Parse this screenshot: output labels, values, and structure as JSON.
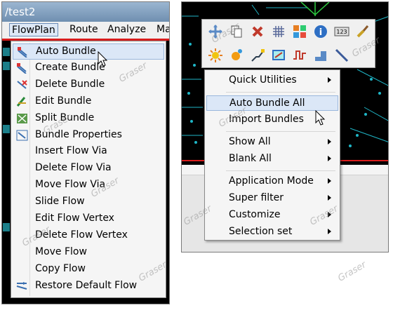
{
  "left_window": {
    "title": "/test2",
    "menubar": [
      "FlowPlan",
      "Route",
      "Analyze",
      "Ma"
    ],
    "dropdown_items": [
      {
        "label": "Auto Bundle",
        "icon": "bundle-icon",
        "highlighted": true
      },
      {
        "label": "Create Bundle",
        "icon": "bundle-icon"
      },
      {
        "label": "Delete Bundle",
        "icon": "bundle-delete-icon"
      },
      {
        "label": "Edit Bundle",
        "icon": "bundle-edit-icon"
      },
      {
        "label": "Split Bundle",
        "icon": "bundle-split-icon"
      },
      {
        "label": "Bundle Properties",
        "icon": "bundle-properties-icon"
      },
      {
        "label": "Insert Flow Via",
        "icon": ""
      },
      {
        "label": "Delete Flow Via",
        "icon": ""
      },
      {
        "label": "Move Flow Via",
        "icon": ""
      },
      {
        "label": "Slide Flow",
        "icon": ""
      },
      {
        "label": "Edit Flow Vertex",
        "icon": ""
      },
      {
        "label": "Delete Flow Vertex",
        "icon": ""
      },
      {
        "label": "Move Flow",
        "icon": ""
      },
      {
        "label": "Copy Flow",
        "icon": ""
      },
      {
        "label": "Restore Default Flow",
        "icon": "restore-flow-icon"
      }
    ]
  },
  "right_window": {
    "toolbar_row1": [
      "move-icon",
      "copy-icon",
      "delete-icon",
      "grid-icon",
      "color-palette-icon",
      "info-icon",
      "measure-icon",
      "brush-icon"
    ],
    "toolbar_row2": [
      "highlight-icon",
      "dehighlight-icon",
      "connect-icon",
      "zoom-fit-icon",
      "wave-icon",
      "step-icon",
      "line-icon"
    ],
    "context_menu": [
      {
        "label": "Quick Utilities",
        "submenu": true
      },
      {
        "sep": true
      },
      {
        "label": "Auto Bundle All",
        "submenu": false,
        "highlighted": true
      },
      {
        "label": "Import Bundles",
        "submenu": false
      },
      {
        "sep": true
      },
      {
        "label": "Show All",
        "submenu": true
      },
      {
        "label": "Blank All",
        "submenu": true
      },
      {
        "sep": true
      },
      {
        "label": "Application Mode",
        "submenu": true
      },
      {
        "label": "Super filter",
        "submenu": true
      },
      {
        "label": "Customize",
        "submenu": true
      },
      {
        "label": "Selection set",
        "submenu": true
      }
    ]
  },
  "watermark": "Graser",
  "colors": {
    "highlight": "#dbe7f7",
    "highlight_border": "#9ab7dc",
    "canvas": "#000000",
    "cyan_trace": "#1fb6c7"
  }
}
